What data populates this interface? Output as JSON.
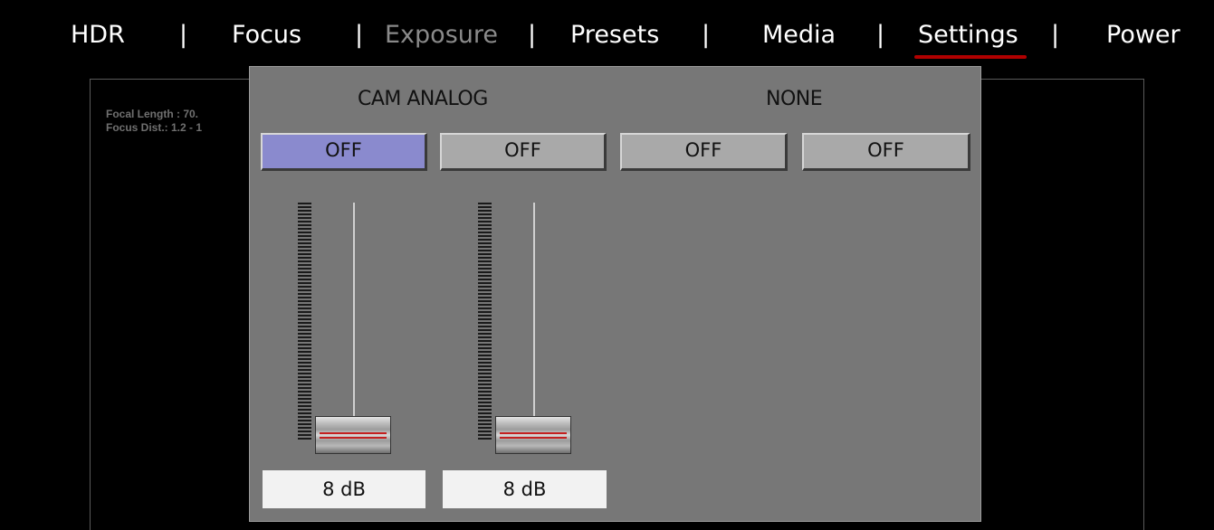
{
  "nav": {
    "items": [
      {
        "label": "HDR",
        "disabled": false
      },
      {
        "label": "Focus",
        "disabled": false
      },
      {
        "label": "Exposure",
        "disabled": true
      },
      {
        "label": "Presets",
        "disabled": false
      },
      {
        "label": "Media",
        "disabled": false
      },
      {
        "label": "Settings",
        "disabled": false,
        "selected": true
      },
      {
        "label": "Power",
        "disabled": false
      }
    ],
    "separator": "|"
  },
  "info": {
    "focal_length": "Focal Length : 70.",
    "focus_dist": "Focus Dist.: 1.2 - 1"
  },
  "audio": {
    "groups": [
      {
        "label": "CAM ANALOG"
      },
      {
        "label": "NONE"
      }
    ],
    "channels": [
      {
        "label": "OFF",
        "active": true
      },
      {
        "label": "OFF",
        "active": false
      },
      {
        "label": "OFF",
        "active": false
      },
      {
        "label": "OFF",
        "active": false
      }
    ],
    "faders": [
      {
        "level_label": "8 dB",
        "position_fraction": 0.0
      },
      {
        "level_label": "8 dB",
        "position_fraction": 0.0
      }
    ]
  },
  "colors": {
    "background": "#000000",
    "popup": "#777777",
    "active_button": "#8a8ace",
    "inactive_button": "#a9a9a9",
    "selected_underline": "#b00000",
    "disabled_text": "#8a8a8a"
  }
}
